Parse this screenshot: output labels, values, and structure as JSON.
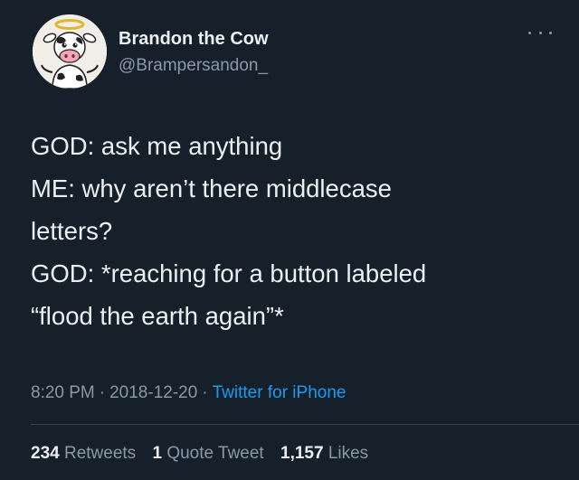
{
  "author": {
    "display_name": "Brandon the Cow",
    "handle": "@Brampersandon_",
    "avatar_icon": "halo-cow-avatar-icon"
  },
  "menu_icon": "more-options-icon",
  "body_lines": [
    "GOD: ask me anything",
    "ME: why aren’t there middlecase",
    "letters?",
    "GOD: *reaching for a button labeled",
    "“flood the earth again”*"
  ],
  "meta": {
    "time": "8:20 PM",
    "separator": "·",
    "date": "2018-12-20",
    "source": "Twitter for iPhone"
  },
  "stats": {
    "retweets_count": "234",
    "retweets_label": "Retweets",
    "quote_count": "1",
    "quote_label": "Quote Tweet",
    "likes_count": "1,157",
    "likes_label": "Likes"
  },
  "colors": {
    "background": "#15202b",
    "text": "#eceff1",
    "secondary": "#8b98a5",
    "accent": "#1d9bf0"
  }
}
